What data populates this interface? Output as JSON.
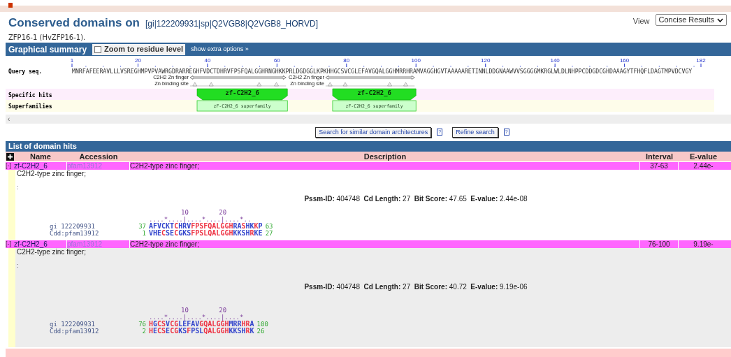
{
  "header": {
    "title": "Conserved domains on",
    "accession": "[gi|122209931|sp|Q2VGB8|Q2VGB8_HORVD]",
    "subtitle": "ZFP16-1 (HvZFP16-1).",
    "view_label": "View",
    "view_value": "Concise Results"
  },
  "graphical_summary": {
    "title": "Graphical summary",
    "zoom_checkbox": {
      "label": "Zoom to residue level",
      "checked": false
    },
    "extra_options": "show extra options »",
    "query_label": "Query seq.",
    "ticks": [
      "1",
      "20",
      "40",
      "60",
      "80",
      "100",
      "120",
      "140",
      "160",
      "182"
    ],
    "sequence": "MNRFAFEERAVLLLVSREGHMPVPVAWRGDRARREGHFVDCTDHRVFPSFQALGGHRNGHKKPRLDGDGGLKPKHHGCSVCGLEFAVGQALGGHMRRHRAMVAGGHGVTAAAAARETINNLDDGNAAWVVSGGGGMKRGLWLDLNHPPCDDGDCGHDAAAGYTFHQFLDAGTMPVDCVGY",
    "specific_label": "Specific hits",
    "superfamilies_label": "Superfamilies",
    "scroll_left": "‹",
    "features": [
      {
        "feature": "C2H2 Zn finger",
        "site": "Zn binding site",
        "name": "zf-C2H2_6",
        "superfamily": "zF-C2H2_6 superfamily"
      },
      {
        "feature": "C2H2 Zn finger",
        "site": "Zn binding site",
        "name": "zf-C2H2_6",
        "superfamily": "zF-C2H2_6 superfamily"
      }
    ]
  },
  "buttons": [
    {
      "label": "Search for similar domain architectures",
      "help": "?"
    },
    {
      "label": "Refine search",
      "help": "?"
    }
  ],
  "domain_hits": {
    "title": "List of domain hits",
    "columns": [
      "Name",
      "Accession",
      "Description",
      "Interval",
      "E-value"
    ],
    "rows": [
      {
        "toggle": "[-]",
        "name": "zf-C2H2_6",
        "accession": "pfam13912",
        "description": "C2H2-type zinc finger;",
        "interval": "37-63",
        "evalue": "2.44e-",
        "selected": false,
        "detail": {
          "text": "C2H2-type zinc finger;",
          "colon": ":",
          "stats": "**Pssm-ID:** 404748  **Cd Length:** 27  **Bit Score:** 47.65  **E-value:** 2.44e-08",
          "ruler_labels": [
            "10",
            "20"
          ],
          "ruler": "....*....|....*....|....*..",
          "rows": [
            {
              "label": "gi 122209931",
              "start": "37",
              "end": "63",
              "segments": [
                {
                  "text": "AFVCKT",
                  "color": "#3344cc"
                },
                {
                  "text": "C",
                  "color": "#ee3344"
                },
                {
                  "text": "HRV",
                  "color": "#3344cc"
                },
                {
                  "text": "FPSFQALGGH",
                  "color": "#ee3344"
                },
                {
                  "text": "RA",
                  "color": "#3344cc"
                },
                {
                  "text": "S",
                  "color": "#ee3344"
                },
                {
                  "text": "HK",
                  "color": "#3344cc"
                },
                {
                  "text": "K",
                  "color": "#ee3344"
                },
                {
                  "text": "P",
                  "color": "#3344cc"
                }
              ]
            },
            {
              "label": "Cdd:pfam13912",
              "start": "1",
              "end": "27",
              "segments": [
                {
                  "text": "VHE",
                  "color": "#3344cc"
                },
                {
                  "text": "C",
                  "color": "#ee3344"
                },
                {
                  "text": "SE",
                  "color": "#3344cc"
                },
                {
                  "text": "C",
                  "color": "#ee3344"
                },
                {
                  "text": "GKS",
                  "color": "#3344cc"
                },
                {
                  "text": "FPSLQALGGH",
                  "color": "#ee3344"
                },
                {
                  "text": "KKSH",
                  "color": "#3344cc"
                },
                {
                  "text": "R",
                  "color": "#ee3344"
                },
                {
                  "text": "KE",
                  "color": "#3344cc"
                }
              ]
            }
          ]
        }
      },
      {
        "toggle": "[-]",
        "name": "zf-C2H2_6",
        "accession": "pfam13912",
        "description": "C2H2-type zinc finger;",
        "interval": "76-100",
        "evalue": "9.19e-",
        "selected": true,
        "detail": {
          "text": "C2H2-type zinc finger;",
          "colon": ":",
          "stats": "**Pssm-ID:** 404748  **Cd Length:** 27  **Bit Score:** 40.72  **E-value:** 9.19e-06",
          "ruler_labels": [
            "10",
            "20"
          ],
          "ruler": "....*....|....*....|....*",
          "rows": [
            {
              "label": "gi 122209931",
              "start": "76",
              "end": "100",
              "segments": [
                {
                  "text": "H",
                  "color": "#ee3344"
                },
                {
                  "text": "G",
                  "color": "#3344cc"
                },
                {
                  "text": "CS",
                  "color": "#ee3344"
                },
                {
                  "text": "V",
                  "color": "#3344cc"
                },
                {
                  "text": "CG",
                  "color": "#ee3344"
                },
                {
                  "text": "LEFAV",
                  "color": "#3344cc"
                },
                {
                  "text": "GQALGGH",
                  "color": "#ee3344"
                },
                {
                  "text": "MRR",
                  "color": "#3344cc"
                },
                {
                  "text": "HR",
                  "color": "#ee3344"
                },
                {
                  "text": "A",
                  "color": "#3344cc"
                }
              ]
            },
            {
              "label": "Cdd:pfam13912",
              "start": "2",
              "end": "26",
              "segments": [
                {
                  "text": "H",
                  "color": "#ee3344"
                },
                {
                  "text": "E",
                  "color": "#3344cc"
                },
                {
                  "text": "CS",
                  "color": "#ee3344"
                },
                {
                  "text": "E",
                  "color": "#3344cc"
                },
                {
                  "text": "CG",
                  "color": "#ee3344"
                },
                {
                  "text": "KS",
                  "color": "#3344cc"
                },
                {
                  "text": "F",
                  "color": "#ee3344"
                },
                {
                  "text": "PSL",
                  "color": "#3344cc"
                },
                {
                  "text": "QALGGH",
                  "color": "#ee3344"
                },
                {
                  "text": "KKSH",
                  "color": "#3344cc"
                },
                {
                  "text": "R",
                  "color": "#ee3344"
                },
                {
                  "text": "K",
                  "color": "#3344cc"
                }
              ]
            }
          ]
        }
      }
    ]
  }
}
